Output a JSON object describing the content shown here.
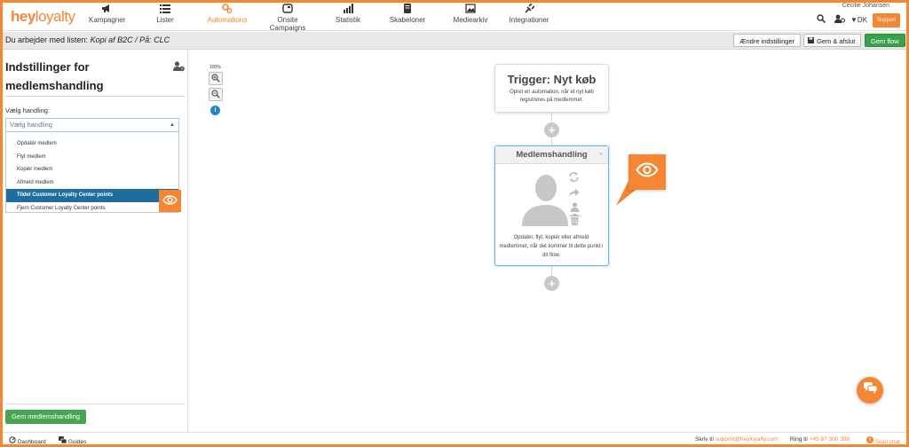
{
  "brand": {
    "logo_bold": "hey",
    "logo_light": "loyalty",
    "accent": "#f58634"
  },
  "nav": {
    "items": [
      {
        "label": "Kampagner",
        "icon": "megaphone-icon"
      },
      {
        "label": "Lister",
        "icon": "list-icon"
      },
      {
        "label": "Automations",
        "icon": "automation-icon",
        "active": true
      },
      {
        "label": "Onsite Campaigns",
        "icon": "onsite-icon"
      },
      {
        "label": "Statistik",
        "icon": "statistics-icon"
      },
      {
        "label": "Skabeloner",
        "icon": "template-icon"
      },
      {
        "label": "Mediearkiv",
        "icon": "image-icon"
      },
      {
        "label": "Integrationer",
        "icon": "plug-icon"
      }
    ],
    "user_name": "Cecilie Johansen",
    "language": "▼DK",
    "support_label": "Support"
  },
  "subheader": {
    "prefix": "Du arbejder med listen:",
    "list_name": "Kopi af B2C",
    "separator": "/ På:",
    "location": "CLC",
    "btn_settings": "Ændre indstillinger",
    "btn_save_close": "Gem & afslut",
    "btn_save_flow": "Gem flow"
  },
  "left_panel": {
    "title": "Indstillinger for medlemshandling",
    "action_label": "Vælg handling:",
    "select_placeholder": "Vælg handling",
    "options_top": [
      "Opdatér medlem",
      "Flyt medlem",
      "Kopiér medlem",
      "Afmeld medlem"
    ],
    "option_selected": "Tildel Customer Loyalty Center points",
    "option_after": "Fjern Customer Loyalty Center points",
    "save_label": "Gem medlemshandling"
  },
  "canvas": {
    "zoom": "100%",
    "trigger_title": "Trigger: Nyt køb",
    "trigger_desc": "Opret en automation, når et nyt køb registreres på medlemmet.",
    "member_title": "Medlemshandling",
    "member_close": "×",
    "member_desc": "Opdater, flyt, kopiér eller afmeld medlemmet, når det kommer til dette punkt i dit flow."
  },
  "footer": {
    "dashboard": "Dashboard",
    "guides": "Guides",
    "write_label": "Skriv til",
    "email": "support@heyloyalty.com",
    "call_label": "Ring til",
    "phone": "+45 87 300 398",
    "hide_chat": "Skjul chat"
  }
}
